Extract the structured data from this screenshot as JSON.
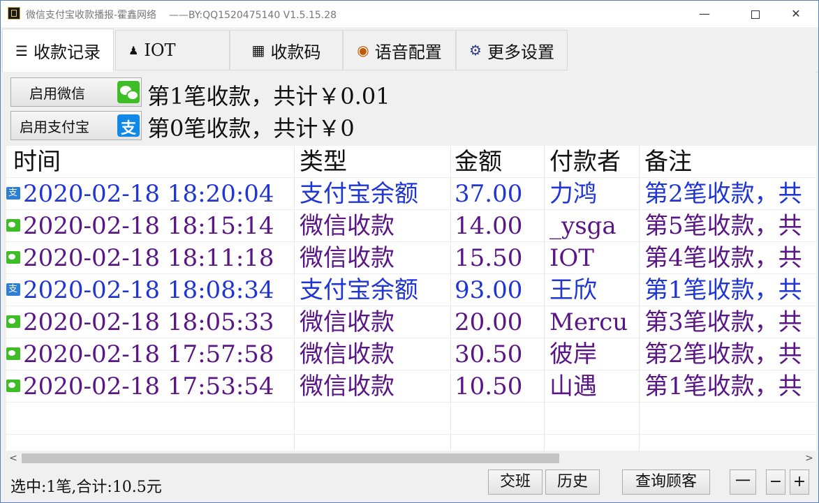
{
  "window": {
    "title": "微信支付宝收款播报-霍鑫网络",
    "subtitle": "——BY:QQ1520475140 V1.5.15.28",
    "min": "—",
    "close": "✕"
  },
  "tabs": [
    {
      "label": "收款记录",
      "icon": "list-icon",
      "glyph": "☰"
    },
    {
      "label": "IOT",
      "icon": "person-icon",
      "glyph": "♟"
    },
    {
      "label": "收款码",
      "icon": "qrcode-icon",
      "glyph": "▦"
    },
    {
      "label": "语音配置",
      "icon": "speaker-icon",
      "glyph": "◉"
    },
    {
      "label": "更多设置",
      "icon": "gear-icon",
      "glyph": "⚙"
    }
  ],
  "summary": {
    "wechat_button": "启用微信",
    "wechat_stat": "第1笔收款，共计￥0.01",
    "alipay_button": "启用支付宝",
    "alipay_badge": "支",
    "alipay_stat": "第0笔收款，共计￥0"
  },
  "table": {
    "headers": {
      "time": "时间",
      "type": "类型",
      "amount": "金额",
      "payer": "付款者",
      "note": "备注"
    },
    "rows": [
      {
        "source": "alipay",
        "time": "2020-02-18 18:20:04",
        "type": "支付宝余额",
        "amount": "37.00",
        "payer": "力鸿",
        "note": "第2笔收款，共"
      },
      {
        "source": "wechat",
        "time": "2020-02-18 18:15:14",
        "type": "微信收款",
        "amount": "14.00",
        "payer": "_ysga",
        "note": "第5笔收款，共"
      },
      {
        "source": "wechat",
        "time": "2020-02-18 18:11:18",
        "type": "微信收款",
        "amount": "15.50",
        "payer": "IOT",
        "note": "第4笔收款，共"
      },
      {
        "source": "alipay",
        "time": "2020-02-18 18:08:34",
        "type": "支付宝余额",
        "amount": "93.00",
        "payer": "王欣",
        "note": "第1笔收款，共"
      },
      {
        "source": "wechat",
        "time": "2020-02-18 18:05:33",
        "type": "微信收款",
        "amount": "20.00",
        "payer": "Mercu",
        "note": "第3笔收款，共"
      },
      {
        "source": "wechat",
        "time": "2020-02-18 17:57:58",
        "type": "微信收款",
        "amount": "30.50",
        "payer": "彼岸",
        "note": "第2笔收款，共"
      },
      {
        "source": "wechat",
        "time": "2020-02-18 17:53:54",
        "type": "微信收款",
        "amount": "10.50",
        "payer": "山遇",
        "note": "第1笔收款，共"
      }
    ]
  },
  "scrollbar": {
    "left": "<",
    "right": ">"
  },
  "status": {
    "selection": "选中:1笔,合计:10.5元",
    "handover": "交班",
    "history": "历史",
    "query_customer": "查询顾客",
    "dash": "一",
    "minus": "−",
    "plus": "+"
  },
  "colors": {
    "wechat_row": "#5a1586",
    "alipay_row": "#1f35d6",
    "wechat_green": "#3ebd27",
    "alipay_blue": "#0f88e8"
  }
}
